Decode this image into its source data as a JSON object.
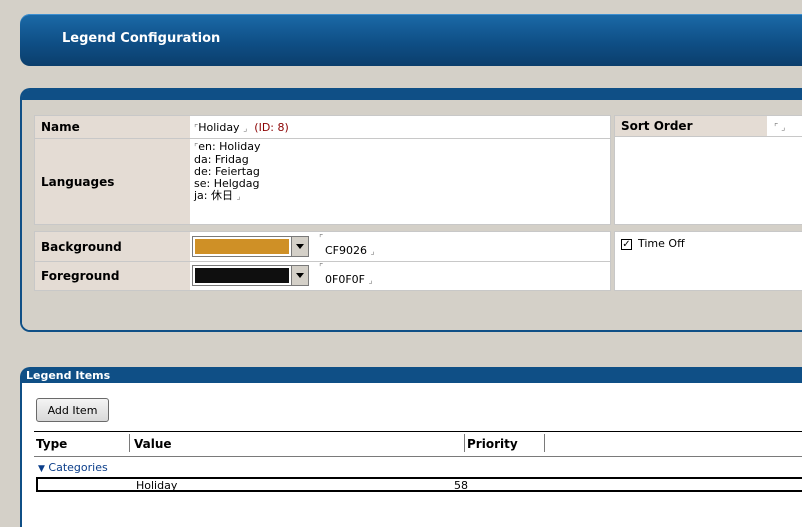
{
  "header": {
    "title": "Legend Configuration"
  },
  "config": {
    "name_label": "Name",
    "name_value": "Holiday",
    "name_id": "(ID: 8)",
    "sort_order_label": "Sort Order",
    "languages_label": "Languages",
    "languages": [
      "en: Holiday",
      "da: Fridag",
      "de: Feiertag",
      "se: Helgdag",
      "ja: 休日"
    ],
    "background_label": "Background",
    "background_color": "#CF9026",
    "background_hex": "CF9026",
    "foreground_label": "Foreground",
    "foreground_color": "#0F0F0F",
    "foreground_hex": "0F0F0F",
    "time_off_label": "Time Off",
    "time_off_checked": true
  },
  "legend_items": {
    "title": "Legend Items",
    "add_button": "Add Item",
    "columns": [
      "Type",
      "Value",
      "Priority"
    ],
    "group": "Categories",
    "rows": [
      {
        "value": "Holiday",
        "priority": "58"
      }
    ]
  },
  "colors": {
    "brand": "#0F4F86",
    "label_bg": "#E4DCD4",
    "window_bg": "#D4D0C8"
  },
  "icons": {
    "dropdown": "triangle-down-icon",
    "expand": "triangle-down-icon",
    "resize": "corner-icon"
  }
}
